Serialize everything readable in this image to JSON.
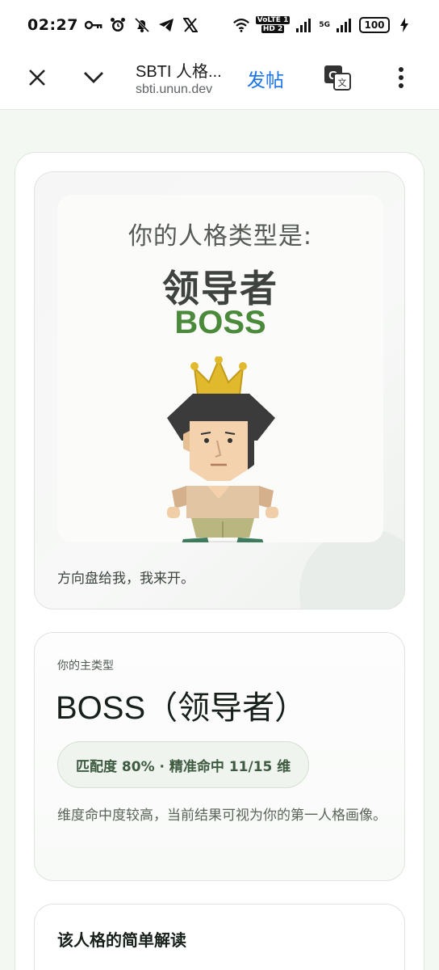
{
  "status_bar": {
    "time": "02:27",
    "network_labels": [
      "6",
      "VoLTE 1",
      "HD 2",
      "R",
      "5G"
    ],
    "battery": "100"
  },
  "toolbar": {
    "page_title": "SBTI 人格...",
    "url": "sbti.unun.dev",
    "post_label": "发帖",
    "icons": [
      "close-icon",
      "chevron-down-icon",
      "translate-icon",
      "more-vert-icon"
    ]
  },
  "hero": {
    "prompt": "你的人格类型是:",
    "name_cn": "领导者",
    "name_en": "BOSS",
    "tagline": "方向盘给我，我来开。"
  },
  "result": {
    "label": "你的主类型",
    "title": "BOSS（领导者）",
    "match": "匹配度 80% · 精准命中 11/15 维",
    "description": "维度命中度较高，当前结果可视为你的第一人格画像。"
  },
  "interpretation": {
    "title": "该人格的简单解读"
  },
  "colors": {
    "accent_green": "#4a8a3a",
    "link_blue": "#1a73e8",
    "page_bg": "#f4f8f3"
  }
}
